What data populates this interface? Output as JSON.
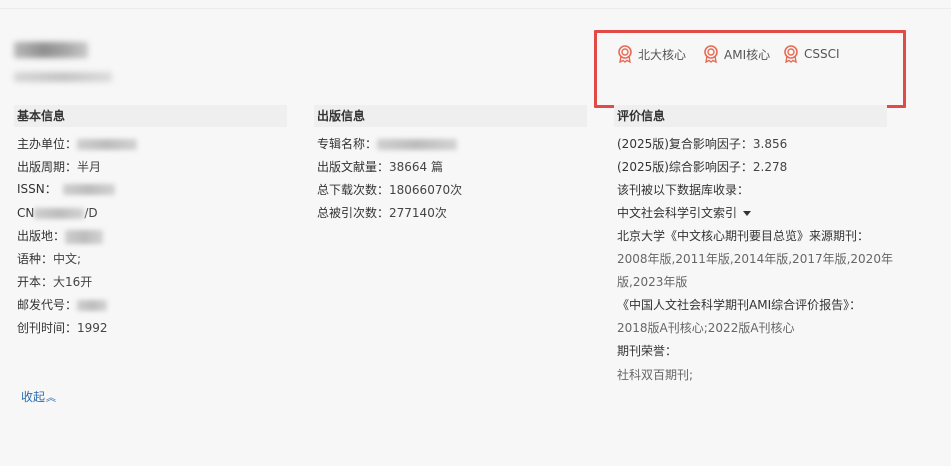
{
  "badges": [
    {
      "label": "北大核心",
      "icon": "award-ribbon-icon"
    },
    {
      "label": "AMI核心",
      "icon": "award-ribbon-icon"
    },
    {
      "label": "CSSCI",
      "icon": "award-ribbon-icon"
    }
  ],
  "accent_color": "#e24a45",
  "badge_icon_color": "#e96b55",
  "link_color": "#2b6cb0",
  "basic": {
    "heading": "基本信息",
    "sponsor_label": "主办单位：",
    "period_label": "出版周期：",
    "period_value": "半月",
    "issn_label": "ISSN：",
    "cn_label": "CN",
    "cn_suffix": "/D",
    "place_label": "出版地：",
    "language_label": "语种：",
    "language_value": "中文;",
    "format_label": "开本：",
    "format_value": "大16开",
    "postcode_label": "邮发代号：",
    "founded_label": "创刊时间：",
    "founded_value": "1992"
  },
  "publication": {
    "heading": "出版信息",
    "album_label": "专辑名称：",
    "volume_label": "出版文献量：",
    "volume_value": "38664 篇",
    "downloads_label": "总下载次数：",
    "downloads_value": "18066070次",
    "citations_label": "总被引次数：",
    "citations_value": "277140次"
  },
  "evaluation": {
    "heading": "评价信息",
    "composite_if_label": "(2025版)复合影响因子：",
    "composite_if_value": "3.856",
    "overall_if_label": "(2025版)综合影响因子：",
    "overall_if_value": "2.278",
    "indexed_label": "该刊被以下数据库收录：",
    "database_dropdown": "中文社会科学引文索引",
    "pku_label": "北京大学《中文核心期刊要目总览》来源期刊：",
    "pku_years_line1": "2008年版,2011年版,2014年版,2017年版,2020年",
    "pku_years_line2": "版,2023年版",
    "ami_label": "《中国人文社会科学期刊AMI综合评价报告》：",
    "ami_value": "2018版A刊核心;2022版A刊核心",
    "honors_label": "期刊荣誉：",
    "honors_value": "社科双百期刊;"
  },
  "collapse_label": "收起",
  "collapse_icon": "double-chevron-up-icon"
}
